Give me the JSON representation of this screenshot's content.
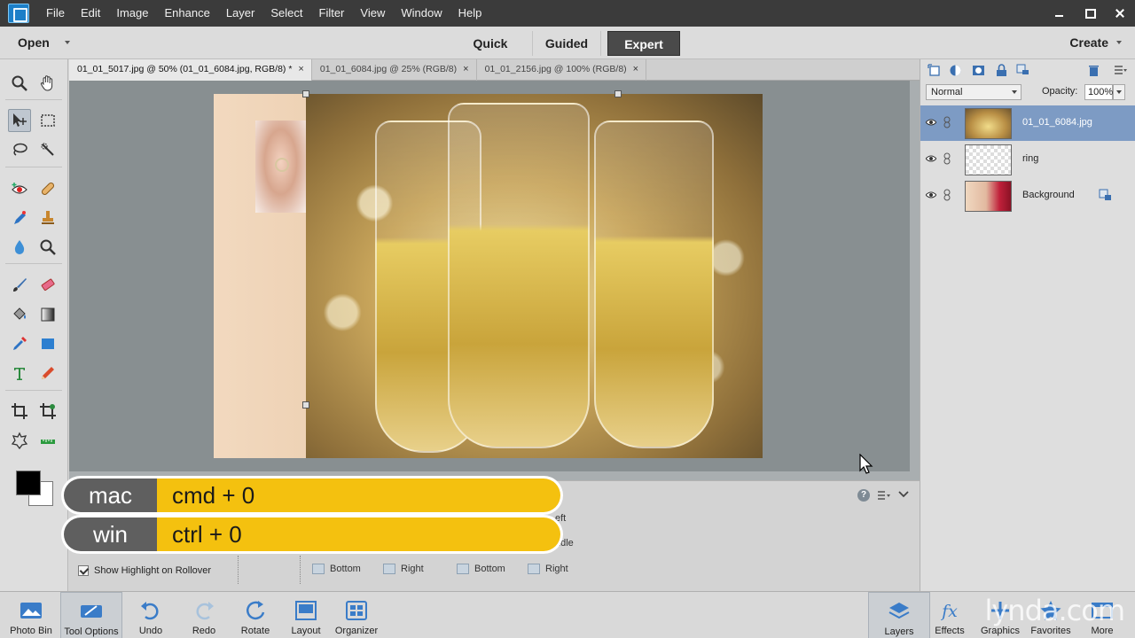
{
  "menu": {
    "items": [
      "File",
      "Edit",
      "Image",
      "Enhance",
      "Layer",
      "Select",
      "Filter",
      "View",
      "Window",
      "Help"
    ]
  },
  "modebar": {
    "open": "Open",
    "modes": [
      "Quick",
      "Guided",
      "Expert"
    ],
    "active_mode": "Expert",
    "create": "Create"
  },
  "doc_tabs": [
    {
      "label": "01_01_5017.jpg @ 50% (01_01_6084.jpg, RGB/8) *",
      "close": "×"
    },
    {
      "label": "01_01_6084.jpg @ 25% (RGB/8)",
      "close": "×"
    },
    {
      "label": "01_01_2156.jpg @ 100% (RGB/8)",
      "close": "×"
    }
  ],
  "layers_panel": {
    "blend_mode": "Normal",
    "opacity_label": "Opacity:",
    "opacity_value": "100%",
    "layers": [
      {
        "name": "01_01_6084.jpg",
        "selected": true
      },
      {
        "name": "ring",
        "selected": false
      },
      {
        "name": "Background",
        "selected": false
      }
    ]
  },
  "tool_options": {
    "help": "?",
    "show_highlight": "Show Highlight on Rollover",
    "partial_left": "eft",
    "partial_middle": "ddle",
    "align_bottom_1": "Bottom",
    "align_right_1": "Right",
    "align_bottom_2": "Bottom",
    "align_right_2": "Right"
  },
  "shortcut": {
    "mac_label": "mac",
    "mac_keys": "cmd + 0",
    "win_label": "win",
    "win_keys": "ctrl + 0"
  },
  "bottombar": {
    "left": [
      "Photo Bin",
      "Tool Options",
      "Undo",
      "Redo",
      "Rotate",
      "Layout",
      "Organizer"
    ],
    "right": [
      "Layers",
      "Effects",
      "Graphics",
      "Favorites",
      "More"
    ]
  },
  "watermark": "lynda.com",
  "colors": {
    "accent": "#f4c10f",
    "selection": "#7d9bc4",
    "menubar": "#3b3b3b"
  }
}
